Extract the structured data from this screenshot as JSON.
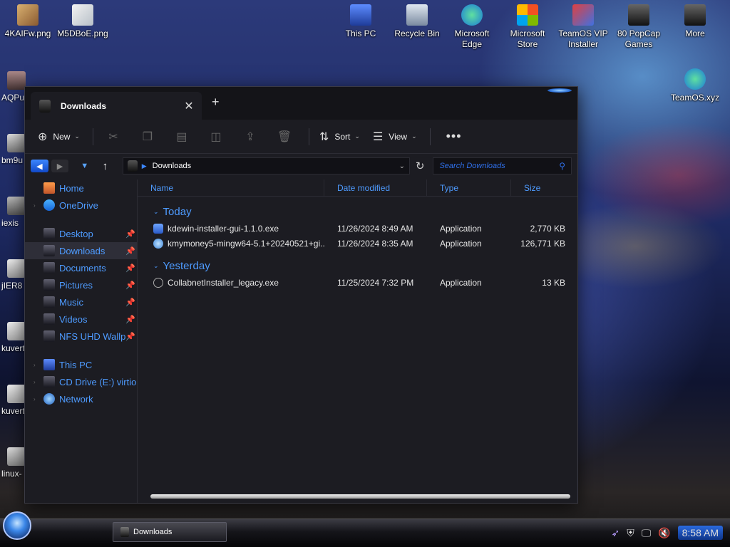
{
  "desktop": {
    "top_icons": [
      {
        "label": "4KAIFw.png",
        "icon": "image-file-icon"
      },
      {
        "label": "M5DBoE.png",
        "icon": "image-file-icon"
      },
      {
        "label": "This PC",
        "icon": "computer-icon"
      },
      {
        "label": "Recycle Bin",
        "icon": "recycle-bin-icon"
      },
      {
        "label": "Microsoft Edge",
        "icon": "edge-icon"
      },
      {
        "label": "Microsoft Store",
        "icon": "store-icon"
      },
      {
        "label": "TeamOS VIP Installer",
        "icon": "installer-icon"
      },
      {
        "label": "80 PopCap Games",
        "icon": "games-icon"
      },
      {
        "label": "More",
        "icon": "folder-icon"
      }
    ],
    "right_icon": {
      "label": "TeamOS.xyz",
      "icon": "edge-icon"
    },
    "left_icons": [
      {
        "label": "AQPu"
      },
      {
        "label": "bm9u"
      },
      {
        "label": "iexis"
      },
      {
        "label": "jIER8"
      },
      {
        "label": "kuvert"
      },
      {
        "label": "kuvert"
      },
      {
        "label": "linux-"
      }
    ]
  },
  "window": {
    "tab_title": "Downloads",
    "close_symbol": "✕",
    "new_tab_symbol": "+"
  },
  "toolbar": {
    "new_label": "New",
    "sort_label": "Sort",
    "view_label": "View",
    "more_symbol": "•••"
  },
  "address": {
    "path": "Downloads",
    "search_placeholder": "Search Downloads"
  },
  "sidebar": {
    "top": [
      {
        "label": "Home",
        "icon": "home-icon"
      },
      {
        "label": "OneDrive",
        "icon": "onedrive-icon"
      }
    ],
    "quick": [
      {
        "label": "Desktop",
        "pinned": true
      },
      {
        "label": "Downloads",
        "pinned": true,
        "selected": true
      },
      {
        "label": "Documents",
        "pinned": true
      },
      {
        "label": "Pictures",
        "pinned": true
      },
      {
        "label": "Music",
        "pinned": true
      },
      {
        "label": "Videos",
        "pinned": true
      },
      {
        "label": "NFS UHD Wallp",
        "pinned": true
      }
    ],
    "bottom": [
      {
        "label": "This PC",
        "icon": "computer-icon"
      },
      {
        "label": "CD Drive (E:) virtio-",
        "icon": "cd-drive-icon"
      },
      {
        "label": "Network",
        "icon": "network-icon"
      }
    ]
  },
  "columns": {
    "name": "Name",
    "date": "Date modified",
    "type": "Type",
    "size": "Size"
  },
  "groups": [
    {
      "label": "Today",
      "files": [
        {
          "name": "kdewin-installer-gui-1.1.0.exe",
          "date": "11/26/2024 8:49 AM",
          "type": "Application",
          "size": "2,770 KB",
          "icon": "kde-app-icon"
        },
        {
          "name": "kmymoney5-mingw64-5.1+20240521+gi...",
          "date": "11/26/2024 8:35 AM",
          "type": "Application",
          "size": "126,771 KB",
          "icon": "kmymoney-app-icon"
        }
      ]
    },
    {
      "label": "Yesterday",
      "files": [
        {
          "name": "CollabnetInstaller_legacy.exe",
          "date": "11/25/2024 7:32 PM",
          "type": "Application",
          "size": "13 KB",
          "icon": "installer-app-icon"
        }
      ]
    }
  ],
  "taskbar": {
    "task_label": "Downloads",
    "clock": "8:58 AM"
  }
}
